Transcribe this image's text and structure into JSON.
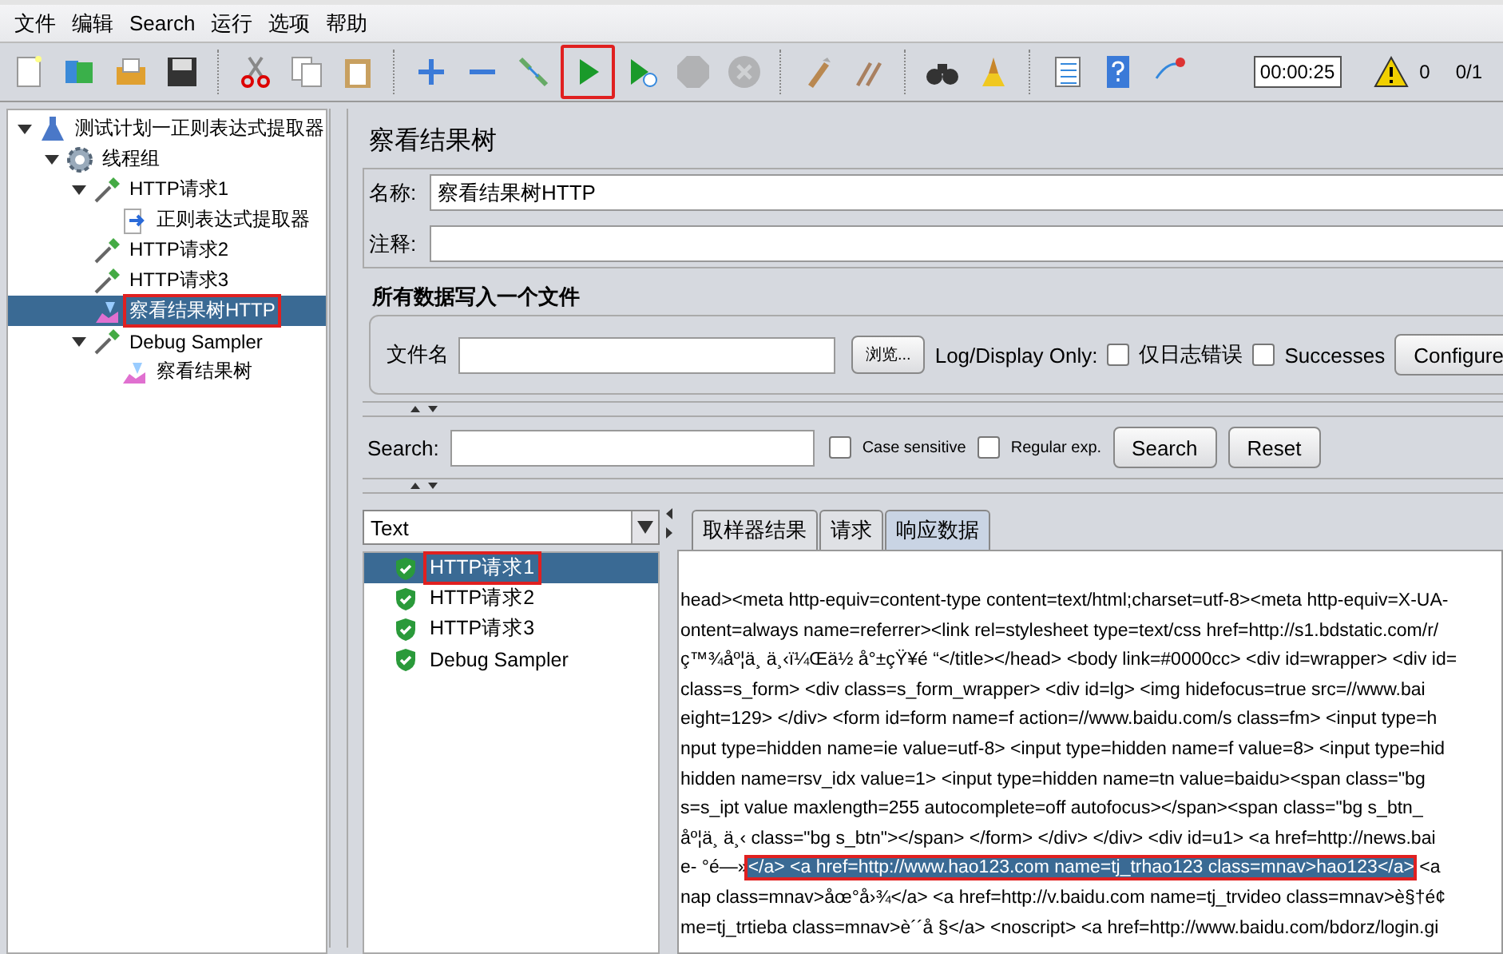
{
  "menu": [
    "文件",
    "编辑",
    "Search",
    "运行",
    "选项",
    "帮助"
  ],
  "toolbar": [
    {
      "kind": "new"
    },
    {
      "kind": "templates"
    },
    {
      "kind": "open"
    },
    {
      "kind": "save"
    },
    {
      "kind": "sep"
    },
    {
      "kind": "cut"
    },
    {
      "kind": "copy"
    },
    {
      "kind": "paste"
    },
    {
      "kind": "sep"
    },
    {
      "kind": "expand"
    },
    {
      "kind": "collapse"
    },
    {
      "kind": "toggle"
    },
    {
      "kind": "start",
      "highlighted": true
    },
    {
      "kind": "start-no-timers",
      "highlighted": false
    },
    {
      "kind": "stop",
      "disabled": true
    },
    {
      "kind": "shutdown",
      "disabled": true
    },
    {
      "kind": "sep"
    },
    {
      "kind": "clear"
    },
    {
      "kind": "clear-all"
    },
    {
      "kind": "sep"
    },
    {
      "kind": "search"
    },
    {
      "kind": "reset-search"
    },
    {
      "kind": "sep"
    },
    {
      "kind": "functions"
    },
    {
      "kind": "help"
    },
    {
      "kind": "remote"
    }
  ],
  "status": {
    "timer": "00:00:25",
    "warnings": "0",
    "threads": "0/1"
  },
  "tree": [
    {
      "label": "测试计划一正则表达式提取器",
      "kind": "plan",
      "expanded": true,
      "selected": false,
      "highlighted": false,
      "children": [
        {
          "label": "线程组",
          "kind": "thread-group",
          "expanded": true,
          "selected": false,
          "highlighted": false,
          "children": [
            {
              "label": "HTTP请求1",
              "kind": "sampler",
              "expanded": true,
              "selected": false,
              "highlighted": false,
              "children": [
                {
                  "label": "正则表达式提取器",
                  "kind": "extractor",
                  "selected": false,
                  "highlighted": false
                }
              ]
            },
            {
              "label": "HTTP请求2",
              "kind": "sampler",
              "selected": false,
              "highlighted": false
            },
            {
              "label": "HTTP请求3",
              "kind": "sampler",
              "selected": false,
              "highlighted": false
            },
            {
              "label": "察看结果树HTTP",
              "kind": "listener",
              "selected": true,
              "highlighted": true
            },
            {
              "label": "Debug Sampler",
              "kind": "sampler",
              "expanded": true,
              "selected": false,
              "highlighted": false,
              "children": [
                {
                  "label": "察看结果树",
                  "kind": "listener",
                  "selected": false,
                  "highlighted": false
                }
              ]
            }
          ]
        }
      ]
    }
  ],
  "panel": {
    "title": "察看结果树",
    "name_label": "名称:",
    "name_value": "察看结果树HTTP",
    "comment_label": "注释:",
    "file_section": "所有数据写入一个文件",
    "file_label": "文件名",
    "browse": "浏览...",
    "log_only": "Log/Display Only:",
    "log_checks": [
      {
        "label": "仅日志错误",
        "checked": false
      },
      {
        "label": "Successes",
        "checked": false
      }
    ],
    "configure": "Configure",
    "search_label": "Search:",
    "search_checks": [
      {
        "label": "Case sensitive",
        "checked": false
      },
      {
        "label": "Regular exp.",
        "checked": false
      }
    ],
    "search_button": "Search",
    "reset_button": "Reset"
  },
  "renderer": "Text",
  "results": [
    {
      "label": "HTTP请求1",
      "success": true,
      "selected": true,
      "highlighted": true
    },
    {
      "label": "HTTP请求2",
      "success": true,
      "selected": false,
      "highlighted": false
    },
    {
      "label": "HTTP请求3",
      "success": true,
      "selected": false,
      "highlighted": false
    },
    {
      "label": "Debug Sampler",
      "success": true,
      "selected": false,
      "highlighted": false
    }
  ],
  "tabs": [
    {
      "label": "取样器结果",
      "selected": false
    },
    {
      "label": "请求",
      "selected": false
    },
    {
      "label": "响应数据",
      "selected": true
    }
  ],
  "response_lines": [
    {
      "text": "head><meta http-equiv=content-type content=text/html;charset=utf-8><meta http-equiv=X-UA-"
    },
    {
      "text": "ontent=always name=referrer><link rel=stylesheet type=text/css href=http://s1.bdstatic.com/r/"
    },
    {
      "text": "ç™¾åº¦ä¸ ä¸‹ï¼Œä½ å°±çŸ¥é “</title></head> <body link=#0000cc> <div id=wrapper> <div id="
    },
    {
      "text": "class=s_form> <div class=s_form_wrapper> <div id=lg> <img hidefocus=true src=//www.bai"
    },
    {
      "text": "eight=129> </div> <form id=form name=f action=//www.baidu.com/s class=fm> <input type=h"
    },
    {
      "text": "nput type=hidden name=ie value=utf-8> <input type=hidden name=f value=8> <input type=hid"
    },
    {
      "text": "hidden name=rsv_idx value=1> <input type=hidden name=tn value=baidu><span class=\"bg"
    },
    {
      "text": "s=s_ipt value maxlength=255 autocomplete=off autofocus></span><span class=\"bg s_btn_"
    },
    {
      "text": "åº¦ä¸ ä¸‹ class=\"bg s_btn\"></span> </form> </div> </div> <div id=u1> <a href=http://news.bai"
    },
    {
      "text": "e- °é—»",
      "highlight": "</a> <a href=http://www.hao123.com name=tj_trhao123 class=mnav>hao123</a>",
      "after": " <a"
    },
    {
      "text": "nap class=mnav>åœ°å›¾</a> <a href=http://v.baidu.com name=tj_trvideo class=mnav>è§†é¢"
    },
    {
      "text": "me=tj_trtieba class=mnav>è´´å §</a> <noscript> <a href=http://www.baidu.com/bdorz/login.gi"
    }
  ]
}
